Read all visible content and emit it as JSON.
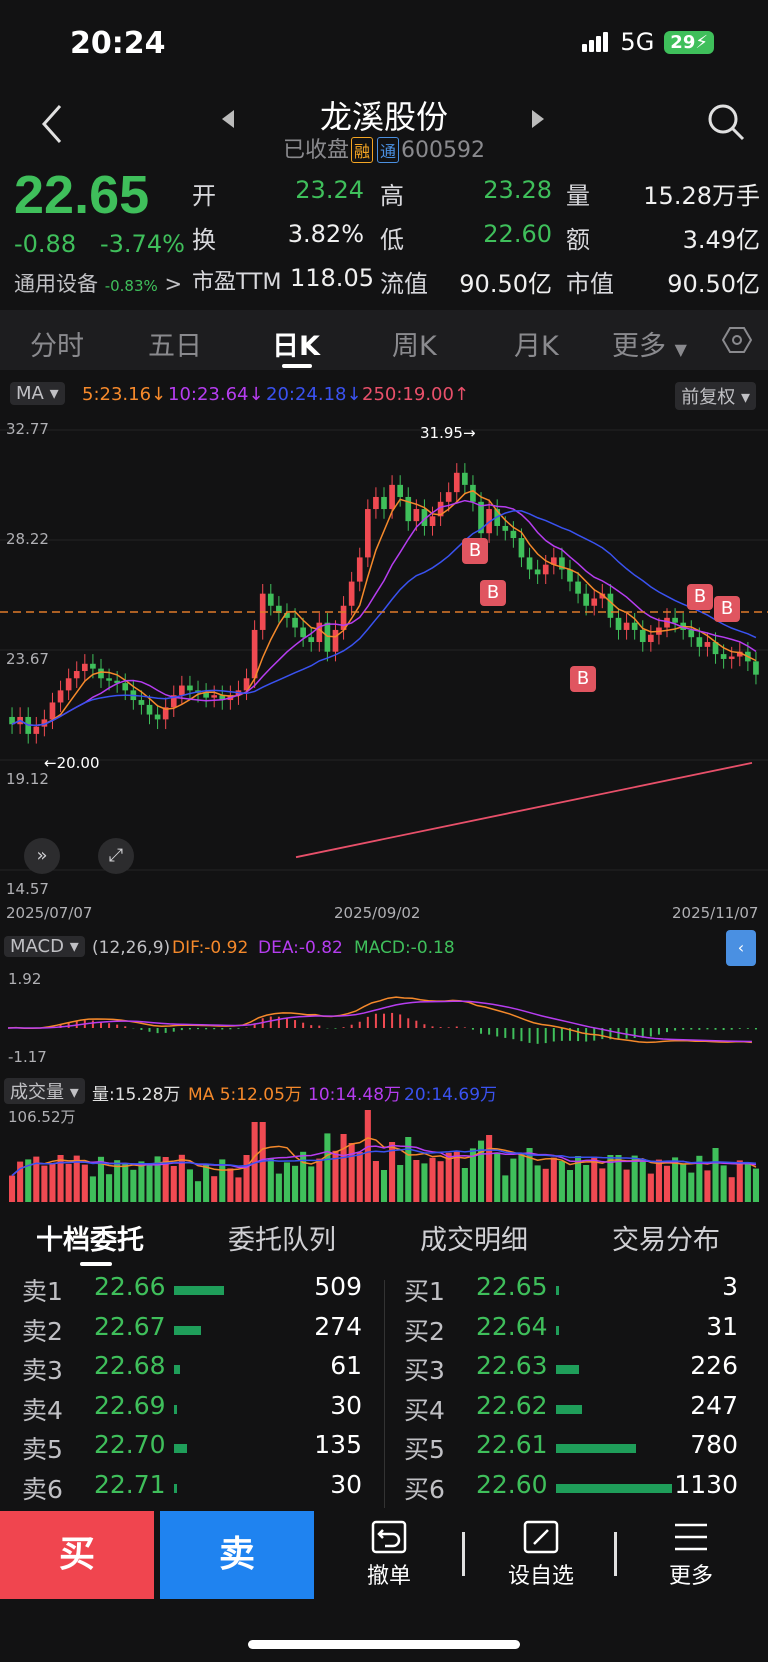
{
  "status": {
    "time": "20:24",
    "network": "5G",
    "battery": "29"
  },
  "header": {
    "title": "龙溪股份",
    "state": "已收盘",
    "tag_margin": "融",
    "tag_connect": "通",
    "code": "600592"
  },
  "quote": {
    "price": "22.65",
    "change": "-0.88",
    "change_pct": "-3.74%",
    "sector": "通用设备",
    "sector_change": "-0.83%",
    "fields": [
      {
        "label": "开",
        "value": "23.24",
        "color": "green"
      },
      {
        "label": "高",
        "value": "23.28",
        "color": "green"
      },
      {
        "label": "量",
        "value": "15.28万手",
        "color": "white"
      },
      {
        "label": "换",
        "value": "3.82%",
        "color": "white"
      },
      {
        "label": "低",
        "value": "22.60",
        "color": "green"
      },
      {
        "label": "额",
        "value": "3.49亿",
        "color": "white"
      },
      {
        "label": "市盈TTM",
        "value": "118.05",
        "color": "white"
      },
      {
        "label": "流值",
        "value": "90.50亿",
        "color": "white"
      },
      {
        "label": "市值",
        "value": "90.50亿",
        "color": "white"
      }
    ]
  },
  "tabs": [
    "分时",
    "五日",
    "日K",
    "周K",
    "月K",
    "更多"
  ],
  "active_tab": "日K",
  "ma_bar": {
    "select": "MA",
    "ma5": "5:23.16↓",
    "ma10": "10:23.64↓",
    "ma20": "20:24.18↓",
    "ma250": "250:19.00↑",
    "adjust": "前复权"
  },
  "colors": {
    "up": "#f04a52",
    "down": "#3fbf5b",
    "ma5": "#f5892b",
    "ma10": "#b63df0",
    "ma20": "#3a52f0",
    "ma250": "#e8506a"
  },
  "chart_data": [
    {
      "type": "candlestick",
      "y_ticks": [
        "32.77",
        "28.22",
        "23.67",
        "19.12",
        "14.57"
      ],
      "ylim": [
        14.57,
        32.77
      ],
      "x_labels": [
        "2025/07/07",
        "2025/09/02",
        "2025/11/07"
      ],
      "annotations": {
        "high": "31.95",
        "low": "20.00",
        "high_marker": "31.95→",
        "low_marker": "←20.00"
      },
      "markers": [
        "B",
        "B",
        "B",
        "B",
        "B"
      ],
      "closes": [
        20.6,
        20.9,
        20.2,
        20.5,
        20.8,
        21.5,
        22.0,
        22.5,
        22.8,
        23.1,
        22.9,
        22.5,
        22.4,
        22.3,
        22.0,
        21.6,
        21.4,
        21.0,
        20.8,
        21.3,
        21.8,
        22.2,
        22.0,
        21.9,
        21.7,
        21.8,
        21.6,
        21.8,
        22.0,
        22.5,
        24.5,
        26.0,
        25.5,
        25.2,
        25.0,
        24.6,
        24.2,
        24.0,
        24.8,
        23.6,
        24.5,
        25.5,
        26.5,
        27.5,
        29.5,
        30.0,
        29.5,
        30.5,
        30.0,
        29.0,
        29.5,
        28.8,
        29.2,
        29.8,
        30.2,
        31.0,
        30.5,
        29.8,
        28.5,
        29.5,
        28.8,
        28.6,
        28.3,
        27.5,
        27.0,
        26.8,
        27.2,
        27.5,
        27.0,
        26.5,
        26.0,
        25.5,
        25.8,
        26.0,
        25.0,
        24.5,
        24.8,
        24.5,
        24.0,
        24.3,
        24.6,
        25.0,
        24.8,
        24.5,
        24.2,
        23.8,
        24.0,
        23.5,
        23.3,
        23.4,
        23.6,
        23.2,
        22.65
      ]
    },
    {
      "type": "bar",
      "name": "MACD",
      "params": "(12,26,9)",
      "dif": "DIF:-0.92",
      "dea": "DEA:-0.82",
      "macd": "MACD:-0.18",
      "y_ticks": [
        "1.92",
        "-1.17"
      ]
    },
    {
      "type": "bar",
      "name": "成交量",
      "vol": "量:15.28万",
      "ma5": "MA 5:12.05万",
      "ma10": "10:14.48万",
      "ma20": "20:14.69万",
      "y_ticks": [
        "106.52万"
      ]
    }
  ],
  "orderbook": {
    "tabs": [
      "十档委托",
      "委托队列",
      "成交明细",
      "交易分布"
    ],
    "sell": [
      {
        "label": "卖1",
        "price": "22.66",
        "qty": "509",
        "bar": 0.43
      },
      {
        "label": "卖2",
        "price": "22.67",
        "qty": "274",
        "bar": 0.23
      },
      {
        "label": "卖3",
        "price": "22.68",
        "qty": "61",
        "bar": 0.05
      },
      {
        "label": "卖4",
        "price": "22.69",
        "qty": "30",
        "bar": 0.02
      },
      {
        "label": "卖5",
        "price": "22.70",
        "qty": "135",
        "bar": 0.11
      },
      {
        "label": "卖6",
        "price": "22.71",
        "qty": "30",
        "bar": 0.02
      }
    ],
    "buy": [
      {
        "label": "买1",
        "price": "22.65",
        "qty": "3",
        "bar": 0.01
      },
      {
        "label": "买2",
        "price": "22.64",
        "qty": "31",
        "bar": 0.02
      },
      {
        "label": "买3",
        "price": "22.63",
        "qty": "226",
        "bar": 0.2
      },
      {
        "label": "买4",
        "price": "22.62",
        "qty": "247",
        "bar": 0.22
      },
      {
        "label": "买5",
        "price": "22.61",
        "qty": "780",
        "bar": 0.69
      },
      {
        "label": "买6",
        "price": "22.60",
        "qty": "1130",
        "bar": 1.0
      }
    ]
  },
  "bottom": {
    "buy": "买",
    "sell": "卖",
    "cancel": "撤单",
    "watch": "设自选",
    "more": "更多"
  }
}
